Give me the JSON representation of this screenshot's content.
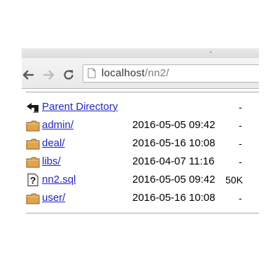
{
  "browser": {
    "tab_fragment": "  ",
    "tab_close": "×",
    "url_host": "localhost",
    "url_path": "/nn2/"
  },
  "listing": {
    "parent": {
      "label": "Parent Directory",
      "size": "-"
    },
    "entries": [
      {
        "name": "admin/",
        "date": "2016-05-05 09:42",
        "size": "-",
        "type": "folder"
      },
      {
        "name": "deal/",
        "date": "2016-05-16 10:08",
        "size": "-",
        "type": "folder"
      },
      {
        "name": "libs/",
        "date": "2016-04-07 11:16",
        "size": "-",
        "type": "folder"
      },
      {
        "name": "nn2.sql",
        "date": "2016-05-05 09:42",
        "size": "50K",
        "type": "unknown-file"
      },
      {
        "name": "user/",
        "date": "2016-05-16 10:08",
        "size": "-",
        "type": "folder"
      }
    ]
  },
  "icons": {
    "back": "back-arrow-icon",
    "forward": "forward-arrow-icon",
    "reload": "reload-icon",
    "page": "page-icon",
    "parent": "back-arrow-icon",
    "folder": "folder-icon",
    "unknown": "unknown-file-icon"
  },
  "colors": {
    "link": "#2323c9",
    "folder": "#e0a44e",
    "toolbar": "#ececec"
  }
}
